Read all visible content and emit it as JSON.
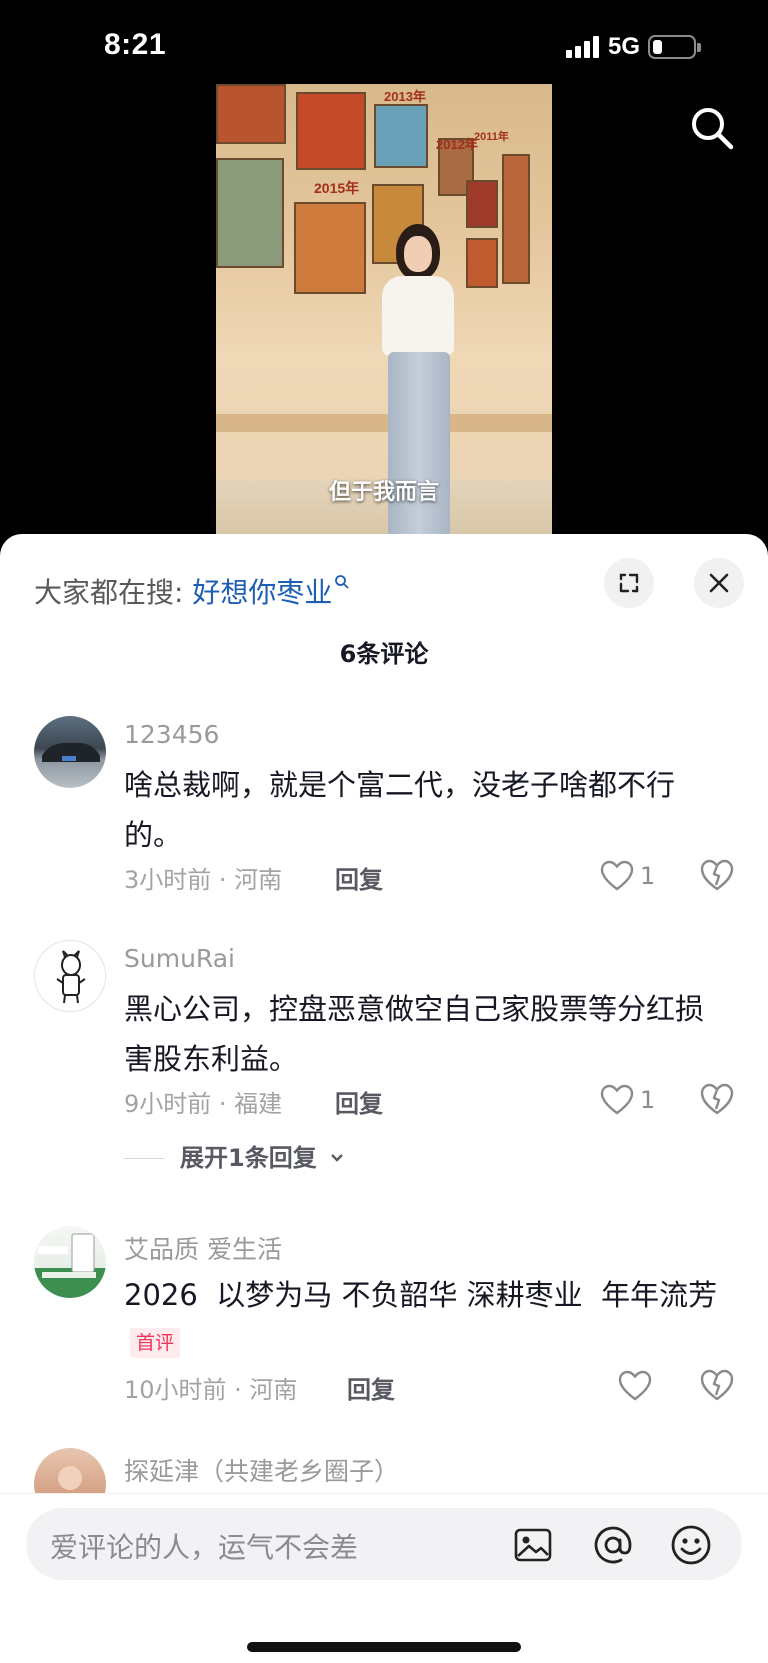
{
  "status": {
    "time": "8:21",
    "network": "5G"
  },
  "video": {
    "subtitle": "但于我而言",
    "year_labels": [
      "2013年",
      "2015年",
      "2012年",
      "2011年"
    ]
  },
  "sheet": {
    "search_prefix": "大家都在搜:",
    "search_term": "好想你枣业",
    "comment_count": "6条评论"
  },
  "comments": [
    {
      "user": "123456",
      "text": "啥总裁啊，就是个富二代，没老子啥都不行的。",
      "time_loc": "3小时前 · 河南",
      "reply": "回复",
      "likes": "1"
    },
    {
      "user": "SumuRai",
      "text": "黑心公司，控盘恶意做空自己家股票等分红损害股东利益。",
      "time_loc": "9小时前 · 福建",
      "reply": "回复",
      "likes": "1",
      "expand": "展开1条回复"
    },
    {
      "user": "艾品质 爱生活",
      "text": "2026  以梦为马 不负韶华 深耕枣业  年年流芳",
      "tag": "首评",
      "time_loc": "10小时前 · 河南",
      "reply": "回复"
    },
    {
      "user": "探延津（共建老乡圈子）"
    }
  ],
  "input": {
    "placeholder": "爱评论的人，运气不会差"
  },
  "icons": [
    "search-icon",
    "expand-icon",
    "close-icon",
    "heart-icon",
    "dislike-icon",
    "image-icon",
    "at-icon",
    "emoji-icon"
  ]
}
